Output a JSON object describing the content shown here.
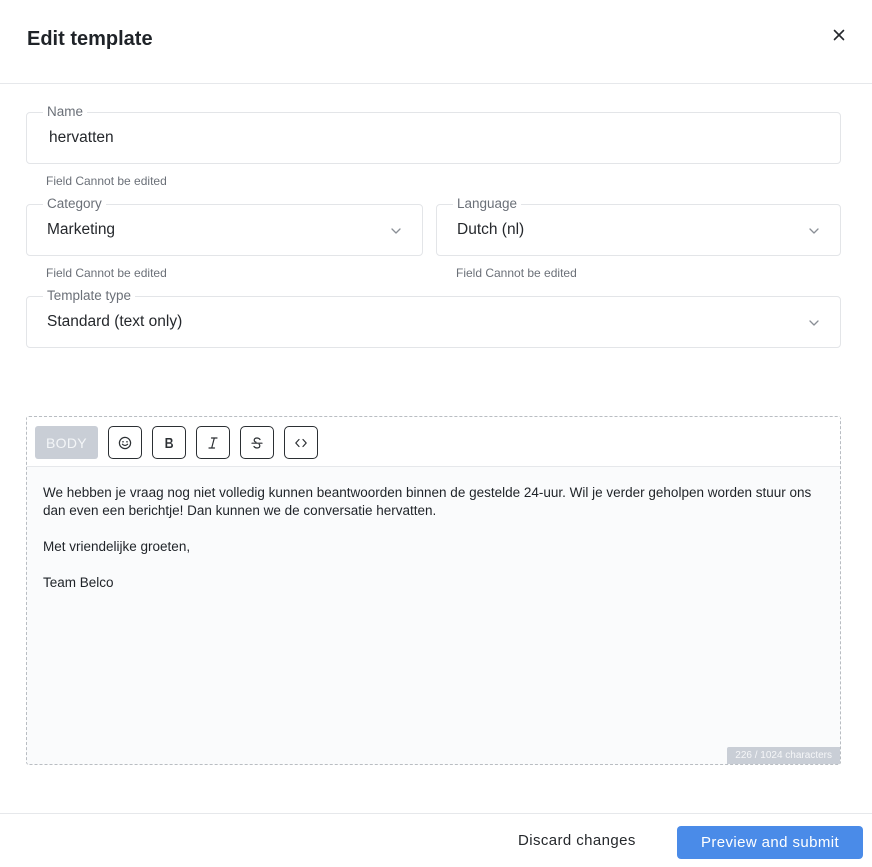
{
  "header": {
    "title": "Edit template",
    "close_icon": "close-icon"
  },
  "form": {
    "name": {
      "label": "Name",
      "value": "hervatten",
      "help": "Field Cannot be edited"
    },
    "category": {
      "label": "Category",
      "value": "Marketing",
      "help": "Field Cannot be edited"
    },
    "language": {
      "label": "Language",
      "value": "Dutch (nl)",
      "help": "Field Cannot be edited"
    },
    "template_type": {
      "label": "Template type",
      "value": "Standard (text only)"
    }
  },
  "editor": {
    "section_label": "BODY",
    "tools": [
      "emoji-icon",
      "bold-icon",
      "italic-icon",
      "strikethrough-icon",
      "code-icon"
    ],
    "lines": [
      "We hebben je vraag nog niet volledig kunnen beantwoorden binnen de gestelde 24-uur. Wil je verder geholpen worden stuur ons dan even een berichtje! Dan kunnen we de conversatie hervatten.",
      "Met vriendelijke groeten,",
      "Team Belco"
    ],
    "counter": "226 / 1024 characters"
  },
  "footer": {
    "discard_label": "Discard changes",
    "submit_label": "Preview and submit"
  },
  "colors": {
    "primary": "#4a8be8",
    "disabled_tag": "#c9ced6"
  }
}
